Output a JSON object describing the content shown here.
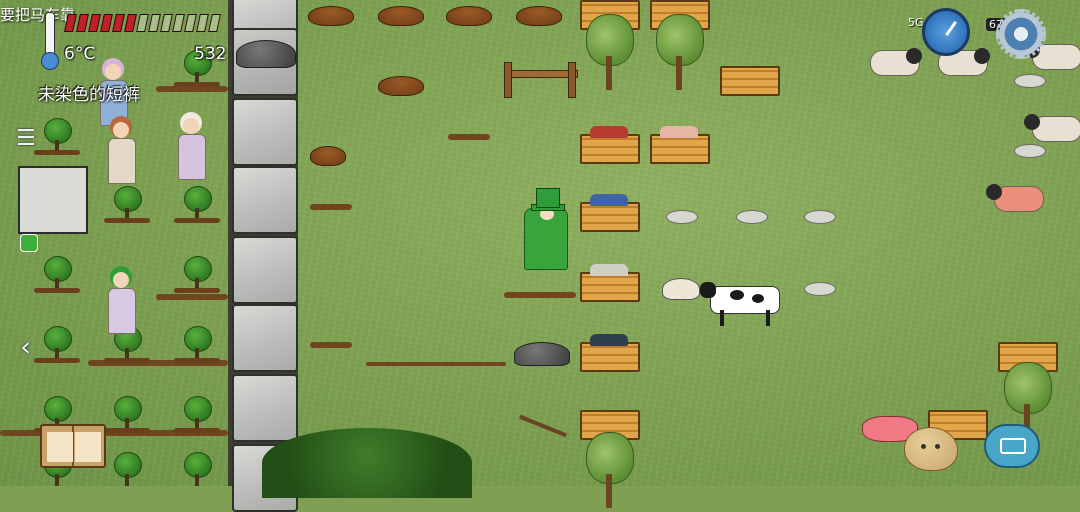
{
  "hud": {
    "chat_message": "要把马车靠",
    "temperature": "6°C",
    "food_counter": "532",
    "held_item_name": "未染色的短裤",
    "food_pips_filled": 6,
    "food_pips_total": 13,
    "status_signal": "5G",
    "status_badge": "67"
  },
  "controls": {
    "menu_icon": "menu-icon",
    "back_icon": "back-chevron-icon",
    "settings_icon": "gear-icon",
    "clock_icon": "clock-icon",
    "recipe_book_icon": "book-icon",
    "emote_icon": "potato-emote-icon",
    "keyboard_icon": "keyboard-icon"
  },
  "colors": {
    "grass": "#7fa052",
    "player_green": "#2f9e3a",
    "food_red": "#c0202a",
    "accent_blue": "#4aa6c9"
  },
  "glyphs": {
    "menu": "☰",
    "back": "‹"
  }
}
